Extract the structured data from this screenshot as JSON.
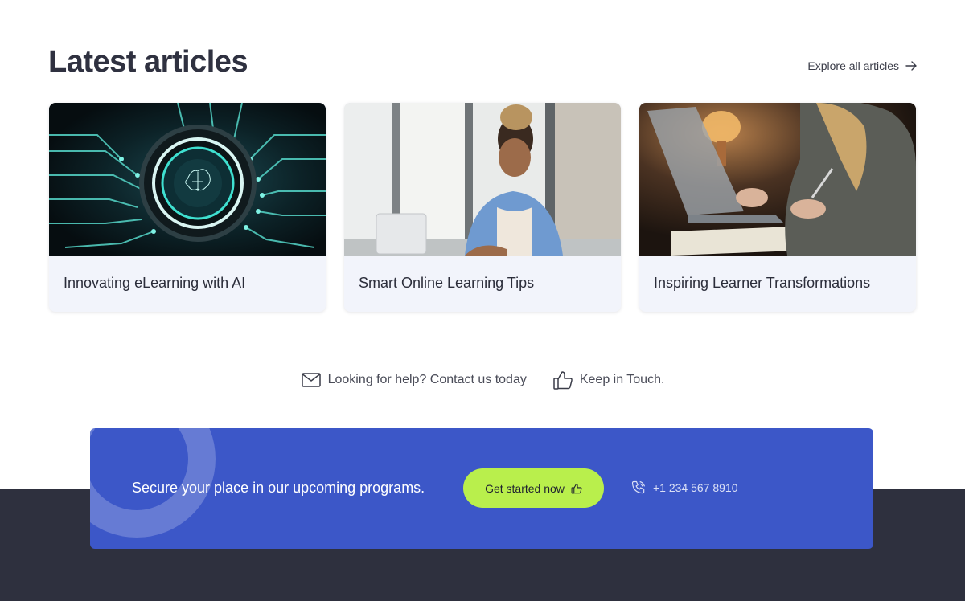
{
  "section": {
    "title": "Latest articles",
    "explore_label": "Explore all articles"
  },
  "articles": [
    {
      "title": "Innovating eLearning with AI",
      "image": "ai-circuit-brain-image"
    },
    {
      "title": "Smart Online Learning Tips",
      "image": "student-laptop-image"
    },
    {
      "title": "Inspiring Learner Transformations",
      "image": "person-writing-notebook-image"
    }
  ],
  "help": {
    "contact_label": "Looking for help? Contact us today",
    "contact_icon": "mail-icon",
    "touch_label": "Keep in Touch.",
    "touch_icon": "thumbs-up-icon"
  },
  "cta": {
    "text": "Secure your place in our upcoming programs.",
    "button_label": "Get started now",
    "phone": "+1 234 567 8910"
  },
  "colors": {
    "cta_background": "#3c57c8",
    "button": "#b9ef4c",
    "footer": "#2e303e",
    "card_body": "#f2f4fb"
  }
}
